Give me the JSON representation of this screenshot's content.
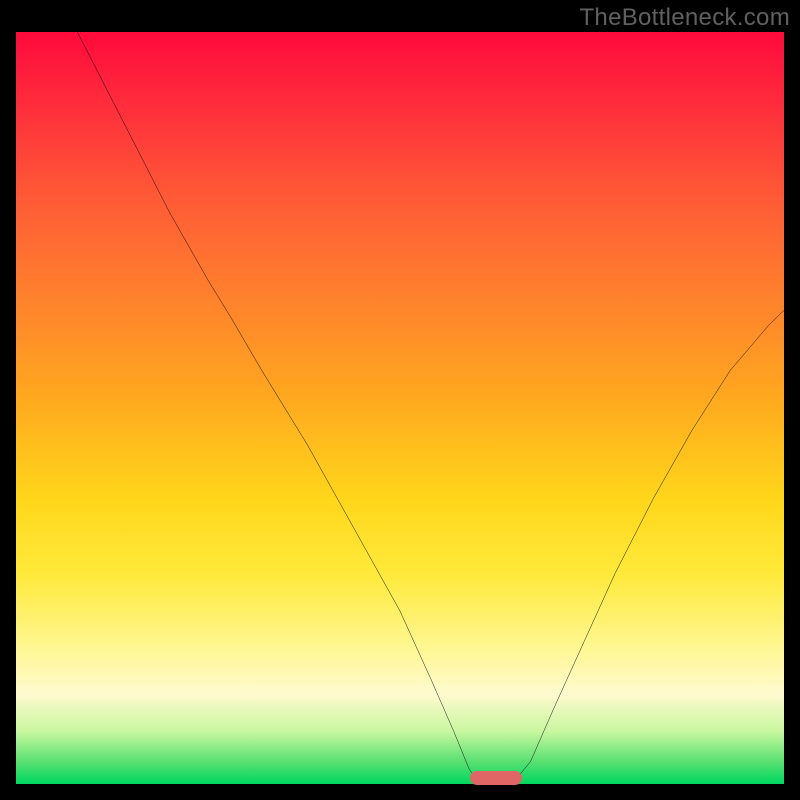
{
  "watermark": "TheBottleneck.com",
  "chart_data": {
    "type": "line",
    "title": "",
    "xlabel": "",
    "ylabel": "",
    "xlim": [
      0,
      100
    ],
    "ylim": [
      0,
      100
    ],
    "background_gradient": {
      "top_color": "#ff0a3c",
      "bottom_color": "#00d760",
      "stops": [
        {
          "pos": 0,
          "color": "#ff0a3c"
        },
        {
          "pos": 10,
          "color": "#ff2e3c"
        },
        {
          "pos": 22,
          "color": "#ff5a36"
        },
        {
          "pos": 34,
          "color": "#ff7d2e"
        },
        {
          "pos": 48,
          "color": "#ffa61f"
        },
        {
          "pos": 62,
          "color": "#ffd61a"
        },
        {
          "pos": 72,
          "color": "#ffe93a"
        },
        {
          "pos": 82,
          "color": "#fff793"
        },
        {
          "pos": 88,
          "color": "#fffacf"
        },
        {
          "pos": 93,
          "color": "#c9f7a0"
        },
        {
          "pos": 97,
          "color": "#5ae072"
        },
        {
          "pos": 100,
          "color": "#00d760"
        }
      ]
    },
    "series": [
      {
        "name": "bottleneck-curve",
        "color": "#000000",
        "points_xy": [
          [
            8,
            100
          ],
          [
            14,
            88
          ],
          [
            20,
            76
          ],
          [
            25,
            67
          ],
          [
            28,
            62
          ],
          [
            32,
            55
          ],
          [
            38,
            45
          ],
          [
            44,
            34
          ],
          [
            50,
            23
          ],
          [
            54,
            14
          ],
          [
            57,
            7
          ],
          [
            59,
            2
          ],
          [
            60,
            0.5
          ],
          [
            62,
            0
          ],
          [
            63.5,
            0
          ],
          [
            65,
            0.5
          ],
          [
            67,
            3
          ],
          [
            70,
            10
          ],
          [
            74,
            19
          ],
          [
            78,
            28
          ],
          [
            83,
            38
          ],
          [
            88,
            47
          ],
          [
            93,
            55
          ],
          [
            98,
            61
          ],
          [
            100,
            63
          ]
        ]
      }
    ],
    "marker": {
      "name": "bottleneck-min-marker",
      "x": 62.5,
      "width_pct": 6.8,
      "color": "#e06666"
    }
  }
}
